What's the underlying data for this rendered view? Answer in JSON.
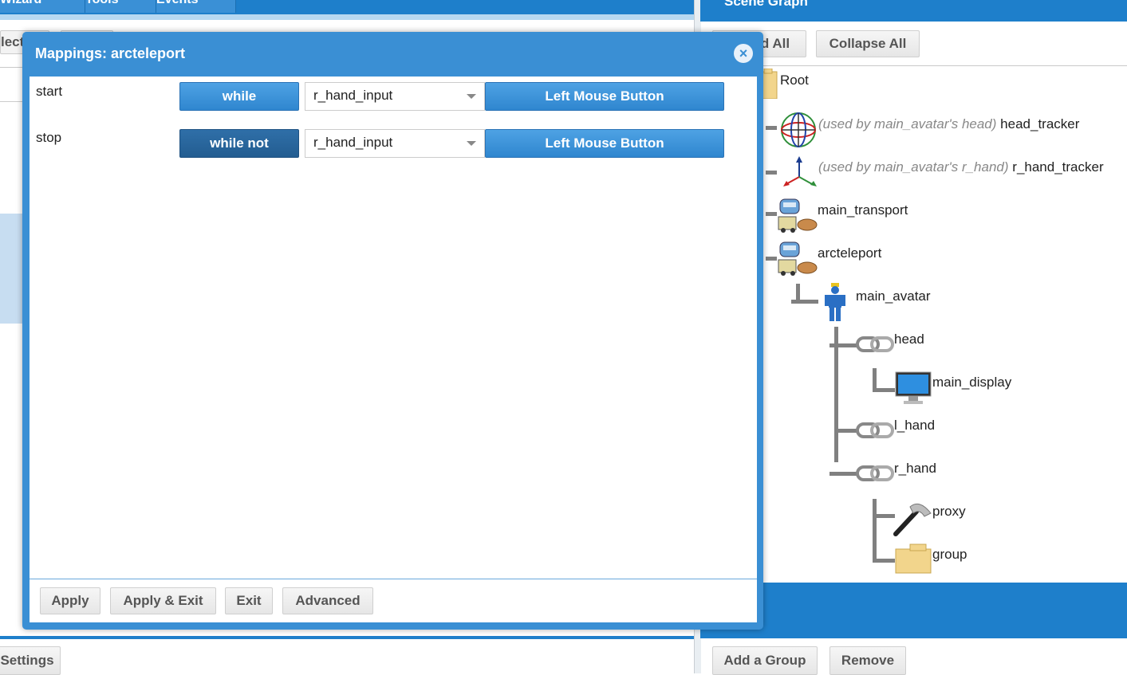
{
  "left_app": {
    "tabs": [
      "Wizard",
      "Tools",
      "Events"
    ],
    "partial_button_1": "lect",
    "settings_button": "Settings"
  },
  "scene_graph": {
    "header_title": "Scene Graph",
    "expand_all_label": "d All",
    "collapse_all_label": "Collapse All",
    "nodes": {
      "root": "Root",
      "head_tracker_used_by": "(used by main_avatar's head)",
      "head_tracker": "head_tracker",
      "r_hand_tracker_used_by": "(used by main_avatar's r_hand)",
      "r_hand_tracker": "r_hand_tracker",
      "main_transport": "main_transport",
      "arcteleport": "arcteleport",
      "main_avatar": "main_avatar",
      "head": "head",
      "main_display": "main_display",
      "l_hand": "l_hand",
      "r_hand": "r_hand",
      "proxy": "proxy",
      "group": "group"
    },
    "add_group_label": "Add a Group",
    "remove_label": "Remove"
  },
  "dialog": {
    "title": "Mappings: arcteleport",
    "close_glyph": "×",
    "mappings": [
      {
        "name": "start",
        "condition": "while",
        "input": "r_hand_input",
        "button": "Left Mouse Button"
      },
      {
        "name": "stop",
        "condition": "while not",
        "input": "r_hand_input",
        "button": "Left Mouse Button"
      }
    ],
    "footer": {
      "apply": "Apply",
      "apply_exit": "Apply & Exit",
      "exit": "Exit",
      "advanced": "Advanced"
    }
  },
  "colors": {
    "accent_blue": "#1e7fcb",
    "dialog_blue": "#3a8fd4",
    "dark_toggle": "#235d91"
  },
  "icons": [
    "folder-icon",
    "tracker-icon",
    "axes-icon",
    "transport-icon",
    "avatar-icon",
    "link-icon",
    "monitor-icon",
    "hammer-icon"
  ]
}
